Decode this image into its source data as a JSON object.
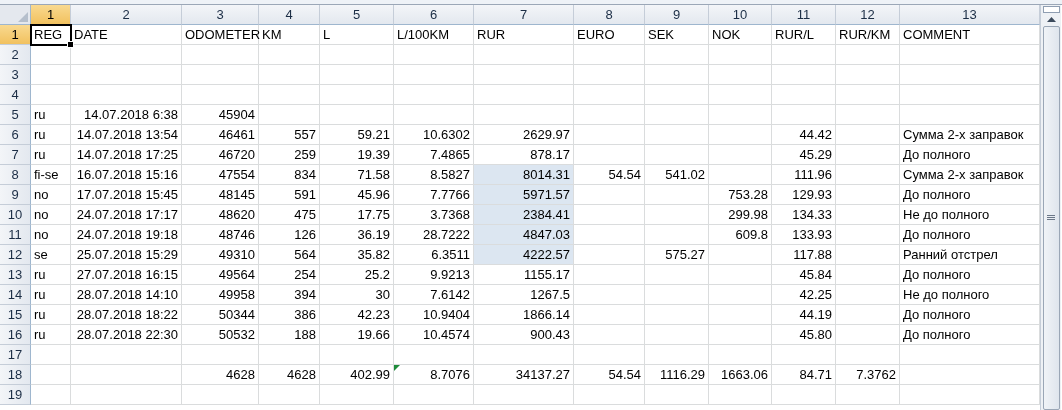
{
  "columns": [
    {
      "label": "1",
      "selected": true,
      "kind": "text"
    },
    {
      "label": "2",
      "selected": false,
      "kind": "number"
    },
    {
      "label": "3",
      "selected": false,
      "kind": "number"
    },
    {
      "label": "4",
      "selected": false,
      "kind": "number"
    },
    {
      "label": "5",
      "selected": false,
      "kind": "number"
    },
    {
      "label": "6",
      "selected": false,
      "kind": "number"
    },
    {
      "label": "7",
      "selected": false,
      "kind": "number"
    },
    {
      "label": "8",
      "selected": false,
      "kind": "number"
    },
    {
      "label": "9",
      "selected": false,
      "kind": "number"
    },
    {
      "label": "10",
      "selected": false,
      "kind": "number"
    },
    {
      "label": "11",
      "selected": false,
      "kind": "number"
    },
    {
      "label": "12",
      "selected": false,
      "kind": "number"
    },
    {
      "label": "13",
      "selected": false,
      "kind": "text"
    }
  ],
  "rows": [
    {
      "label": "1",
      "selected": true,
      "kind": "header",
      "cells": [
        {
          "text": "REG",
          "selected": true,
          "shaded": false,
          "flagged": false
        },
        {
          "text": "DATE",
          "selected": false,
          "shaded": false,
          "flagged": false
        },
        {
          "text": "ODOMETER",
          "selected": false,
          "shaded": false,
          "flagged": false
        },
        {
          "text": "KM",
          "selected": false,
          "shaded": false,
          "flagged": false
        },
        {
          "text": "L",
          "selected": false,
          "shaded": false,
          "flagged": false
        },
        {
          "text": "L/100KM",
          "selected": false,
          "shaded": false,
          "flagged": false
        },
        {
          "text": "RUR",
          "selected": false,
          "shaded": false,
          "flagged": false
        },
        {
          "text": "EURO",
          "selected": false,
          "shaded": false,
          "flagged": false
        },
        {
          "text": "SEK",
          "selected": false,
          "shaded": false,
          "flagged": false
        },
        {
          "text": "NOK",
          "selected": false,
          "shaded": false,
          "flagged": false
        },
        {
          "text": "RUR/L",
          "selected": false,
          "shaded": false,
          "flagged": false
        },
        {
          "text": "RUR/KM",
          "selected": false,
          "shaded": false,
          "flagged": false
        },
        {
          "text": "COMMENT",
          "selected": false,
          "shaded": false,
          "flagged": false
        }
      ]
    },
    {
      "label": "2",
      "selected": false
    },
    {
      "label": "3",
      "selected": false
    },
    {
      "label": "4",
      "selected": false
    },
    {
      "label": "5",
      "selected": false,
      "kind": "data",
      "cells": [
        {
          "text": "ru",
          "selected": false,
          "shaded": false,
          "flagged": false
        },
        {
          "text": "14.07.2018 6:38",
          "selected": false,
          "shaded": false,
          "flagged": false
        },
        {
          "text": "45904",
          "selected": false,
          "shaded": false,
          "flagged": false
        },
        null,
        null,
        null,
        null,
        null,
        null,
        null,
        null,
        null,
        null
      ]
    },
    {
      "label": "6",
      "selected": false,
      "kind": "data",
      "cells": [
        {
          "text": "ru",
          "selected": false,
          "shaded": false,
          "flagged": false
        },
        {
          "text": "14.07.2018 13:54",
          "selected": false,
          "shaded": false,
          "flagged": false
        },
        {
          "text": "46461",
          "selected": false,
          "shaded": false,
          "flagged": false
        },
        {
          "text": "557",
          "selected": false,
          "shaded": false,
          "flagged": false
        },
        {
          "text": "59.21",
          "selected": false,
          "shaded": false,
          "flagged": false
        },
        {
          "text": "10.6302",
          "selected": false,
          "shaded": false,
          "flagged": false
        },
        {
          "text": "2629.97",
          "selected": false,
          "shaded": false,
          "flagged": false
        },
        null,
        null,
        null,
        {
          "text": "44.42",
          "selected": false,
          "shaded": false,
          "flagged": false
        },
        null,
        {
          "text": "Сумма 2-х заправок",
          "selected": false,
          "shaded": false,
          "flagged": false
        }
      ]
    },
    {
      "label": "7",
      "selected": false,
      "kind": "data",
      "cells": [
        {
          "text": "ru",
          "selected": false,
          "shaded": false,
          "flagged": false
        },
        {
          "text": "14.07.2018 17:25",
          "selected": false,
          "shaded": false,
          "flagged": false
        },
        {
          "text": "46720",
          "selected": false,
          "shaded": false,
          "flagged": false
        },
        {
          "text": "259",
          "selected": false,
          "shaded": false,
          "flagged": false
        },
        {
          "text": "19.39",
          "selected": false,
          "shaded": false,
          "flagged": false
        },
        {
          "text": "7.4865",
          "selected": false,
          "shaded": false,
          "flagged": false
        },
        {
          "text": "878.17",
          "selected": false,
          "shaded": false,
          "flagged": false
        },
        null,
        null,
        null,
        {
          "text": "45.29",
          "selected": false,
          "shaded": false,
          "flagged": false
        },
        null,
        {
          "text": "До полного",
          "selected": false,
          "shaded": false,
          "flagged": false
        }
      ]
    },
    {
      "label": "8",
      "selected": false,
      "kind": "data",
      "cells": [
        {
          "text": "fi-se",
          "selected": false,
          "shaded": false,
          "flagged": false
        },
        {
          "text": "16.07.2018 15:16",
          "selected": false,
          "shaded": false,
          "flagged": false
        },
        {
          "text": "47554",
          "selected": false,
          "shaded": false,
          "flagged": false
        },
        {
          "text": "834",
          "selected": false,
          "shaded": false,
          "flagged": false
        },
        {
          "text": "71.58",
          "selected": false,
          "shaded": false,
          "flagged": false
        },
        {
          "text": "8.5827",
          "selected": false,
          "shaded": false,
          "flagged": false
        },
        {
          "text": "8014.31",
          "selected": false,
          "shaded": true,
          "flagged": false
        },
        {
          "text": "54.54",
          "selected": false,
          "shaded": false,
          "flagged": false
        },
        {
          "text": "541.02",
          "selected": false,
          "shaded": false,
          "flagged": false
        },
        null,
        {
          "text": "111.96",
          "selected": false,
          "shaded": false,
          "flagged": false
        },
        null,
        {
          "text": "Сумма 2-х заправок",
          "selected": false,
          "shaded": false,
          "flagged": false
        }
      ]
    },
    {
      "label": "9",
      "selected": false,
      "kind": "data",
      "cells": [
        {
          "text": "no",
          "selected": false,
          "shaded": false,
          "flagged": false
        },
        {
          "text": "17.07.2018 15:45",
          "selected": false,
          "shaded": false,
          "flagged": false
        },
        {
          "text": "48145",
          "selected": false,
          "shaded": false,
          "flagged": false
        },
        {
          "text": "591",
          "selected": false,
          "shaded": false,
          "flagged": false
        },
        {
          "text": "45.96",
          "selected": false,
          "shaded": false,
          "flagged": false
        },
        {
          "text": "7.7766",
          "selected": false,
          "shaded": false,
          "flagged": false
        },
        {
          "text": "5971.57",
          "selected": false,
          "shaded": true,
          "flagged": false
        },
        null,
        null,
        {
          "text": "753.28",
          "selected": false,
          "shaded": false,
          "flagged": false
        },
        {
          "text": "129.93",
          "selected": false,
          "shaded": false,
          "flagged": false
        },
        null,
        {
          "text": "До полного",
          "selected": false,
          "shaded": false,
          "flagged": false
        }
      ]
    },
    {
      "label": "10",
      "selected": false,
      "kind": "data",
      "cells": [
        {
          "text": "no",
          "selected": false,
          "shaded": false,
          "flagged": false
        },
        {
          "text": "24.07.2018 17:17",
          "selected": false,
          "shaded": false,
          "flagged": false
        },
        {
          "text": "48620",
          "selected": false,
          "shaded": false,
          "flagged": false
        },
        {
          "text": "475",
          "selected": false,
          "shaded": false,
          "flagged": false
        },
        {
          "text": "17.75",
          "selected": false,
          "shaded": false,
          "flagged": false
        },
        {
          "text": "3.7368",
          "selected": false,
          "shaded": false,
          "flagged": false
        },
        {
          "text": "2384.41",
          "selected": false,
          "shaded": true,
          "flagged": false
        },
        null,
        null,
        {
          "text": "299.98",
          "selected": false,
          "shaded": false,
          "flagged": false
        },
        {
          "text": "134.33",
          "selected": false,
          "shaded": false,
          "flagged": false
        },
        null,
        {
          "text": "Не до полного",
          "selected": false,
          "shaded": false,
          "flagged": false
        }
      ]
    },
    {
      "label": "11",
      "selected": false,
      "kind": "data",
      "cells": [
        {
          "text": "no",
          "selected": false,
          "shaded": false,
          "flagged": false
        },
        {
          "text": "24.07.2018 19:18",
          "selected": false,
          "shaded": false,
          "flagged": false
        },
        {
          "text": "48746",
          "selected": false,
          "shaded": false,
          "flagged": false
        },
        {
          "text": "126",
          "selected": false,
          "shaded": false,
          "flagged": false
        },
        {
          "text": "36.19",
          "selected": false,
          "shaded": false,
          "flagged": false
        },
        {
          "text": "28.7222",
          "selected": false,
          "shaded": false,
          "flagged": false
        },
        {
          "text": "4847.03",
          "selected": false,
          "shaded": true,
          "flagged": false
        },
        null,
        null,
        {
          "text": "609.8",
          "selected": false,
          "shaded": false,
          "flagged": false
        },
        {
          "text": "133.93",
          "selected": false,
          "shaded": false,
          "flagged": false
        },
        null,
        {
          "text": "До полного",
          "selected": false,
          "shaded": false,
          "flagged": false
        }
      ]
    },
    {
      "label": "12",
      "selected": false,
      "kind": "data",
      "cells": [
        {
          "text": "se",
          "selected": false,
          "shaded": false,
          "flagged": false
        },
        {
          "text": "25.07.2018 15:29",
          "selected": false,
          "shaded": false,
          "flagged": false
        },
        {
          "text": "49310",
          "selected": false,
          "shaded": false,
          "flagged": false
        },
        {
          "text": "564",
          "selected": false,
          "shaded": false,
          "flagged": false
        },
        {
          "text": "35.82",
          "selected": false,
          "shaded": false,
          "flagged": false
        },
        {
          "text": "6.3511",
          "selected": false,
          "shaded": false,
          "flagged": false
        },
        {
          "text": "4222.57",
          "selected": false,
          "shaded": true,
          "flagged": false
        },
        null,
        {
          "text": "575.27",
          "selected": false,
          "shaded": false,
          "flagged": false
        },
        null,
        {
          "text": "117.88",
          "selected": false,
          "shaded": false,
          "flagged": false
        },
        null,
        {
          "text": "Ранний отстрел",
          "selected": false,
          "shaded": false,
          "flagged": false
        }
      ]
    },
    {
      "label": "13",
      "selected": false,
      "kind": "data",
      "cells": [
        {
          "text": "ru",
          "selected": false,
          "shaded": false,
          "flagged": false
        },
        {
          "text": "27.07.2018 16:15",
          "selected": false,
          "shaded": false,
          "flagged": false
        },
        {
          "text": "49564",
          "selected": false,
          "shaded": false,
          "flagged": false
        },
        {
          "text": "254",
          "selected": false,
          "shaded": false,
          "flagged": false
        },
        {
          "text": "25.2",
          "selected": false,
          "shaded": false,
          "flagged": false
        },
        {
          "text": "9.9213",
          "selected": false,
          "shaded": false,
          "flagged": false
        },
        {
          "text": "1155.17",
          "selected": false,
          "shaded": false,
          "flagged": false
        },
        null,
        null,
        null,
        {
          "text": "45.84",
          "selected": false,
          "shaded": false,
          "flagged": false
        },
        null,
        {
          "text": "До полного",
          "selected": false,
          "shaded": false,
          "flagged": false
        }
      ]
    },
    {
      "label": "14",
      "selected": false,
      "kind": "data",
      "cells": [
        {
          "text": "ru",
          "selected": false,
          "shaded": false,
          "flagged": false
        },
        {
          "text": "28.07.2018 14:10",
          "selected": false,
          "shaded": false,
          "flagged": false
        },
        {
          "text": "49958",
          "selected": false,
          "shaded": false,
          "flagged": false
        },
        {
          "text": "394",
          "selected": false,
          "shaded": false,
          "flagged": false
        },
        {
          "text": "30",
          "selected": false,
          "shaded": false,
          "flagged": false
        },
        {
          "text": "7.6142",
          "selected": false,
          "shaded": false,
          "flagged": false
        },
        {
          "text": "1267.5",
          "selected": false,
          "shaded": false,
          "flagged": false
        },
        null,
        null,
        null,
        {
          "text": "42.25",
          "selected": false,
          "shaded": false,
          "flagged": false
        },
        null,
        {
          "text": "Не до полного",
          "selected": false,
          "shaded": false,
          "flagged": false
        }
      ]
    },
    {
      "label": "15",
      "selected": false,
      "kind": "data",
      "cells": [
        {
          "text": "ru",
          "selected": false,
          "shaded": false,
          "flagged": false
        },
        {
          "text": "28.07.2018 18:22",
          "selected": false,
          "shaded": false,
          "flagged": false
        },
        {
          "text": "50344",
          "selected": false,
          "shaded": false,
          "flagged": false
        },
        {
          "text": "386",
          "selected": false,
          "shaded": false,
          "flagged": false
        },
        {
          "text": "42.23",
          "selected": false,
          "shaded": false,
          "flagged": false
        },
        {
          "text": "10.9404",
          "selected": false,
          "shaded": false,
          "flagged": false
        },
        {
          "text": "1866.14",
          "selected": false,
          "shaded": false,
          "flagged": false
        },
        null,
        null,
        null,
        {
          "text": "44.19",
          "selected": false,
          "shaded": false,
          "flagged": false
        },
        null,
        {
          "text": "До полного",
          "selected": false,
          "shaded": false,
          "flagged": false
        }
      ]
    },
    {
      "label": "16",
      "selected": false,
      "kind": "data",
      "cells": [
        {
          "text": "ru",
          "selected": false,
          "shaded": false,
          "flagged": false
        },
        {
          "text": "28.07.2018 22:30",
          "selected": false,
          "shaded": false,
          "flagged": false
        },
        {
          "text": "50532",
          "selected": false,
          "shaded": false,
          "flagged": false
        },
        {
          "text": "188",
          "selected": false,
          "shaded": false,
          "flagged": false
        },
        {
          "text": "19.66",
          "selected": false,
          "shaded": false,
          "flagged": false
        },
        {
          "text": "10.4574",
          "selected": false,
          "shaded": false,
          "flagged": false
        },
        {
          "text": "900.43",
          "selected": false,
          "shaded": false,
          "flagged": false
        },
        null,
        null,
        null,
        {
          "text": "45.80",
          "selected": false,
          "shaded": false,
          "flagged": false
        },
        null,
        {
          "text": "До полного",
          "selected": false,
          "shaded": false,
          "flagged": false
        }
      ]
    },
    {
      "label": "17",
      "selected": false
    },
    {
      "label": "18",
      "selected": false,
      "kind": "data",
      "cells": [
        null,
        null,
        {
          "text": "4628",
          "selected": false,
          "shaded": false,
          "flagged": false
        },
        {
          "text": "4628",
          "selected": false,
          "shaded": false,
          "flagged": false
        },
        {
          "text": "402.99",
          "selected": false,
          "shaded": false,
          "flagged": false
        },
        {
          "text": "8.7076",
          "selected": false,
          "shaded": false,
          "flagged": true
        },
        {
          "text": "34137.27",
          "selected": false,
          "shaded": false,
          "flagged": false
        },
        {
          "text": "54.54",
          "selected": false,
          "shaded": false,
          "flagged": false
        },
        {
          "text": "1116.29",
          "selected": false,
          "shaded": false,
          "flagged": false
        },
        {
          "text": "1663.06",
          "selected": false,
          "shaded": false,
          "flagged": false
        },
        {
          "text": "84.71",
          "selected": false,
          "shaded": false,
          "flagged": false
        },
        {
          "text": "7.3762",
          "selected": false,
          "shaded": false,
          "flagged": false
        },
        null
      ]
    },
    {
      "label": "19",
      "selected": false
    }
  ]
}
